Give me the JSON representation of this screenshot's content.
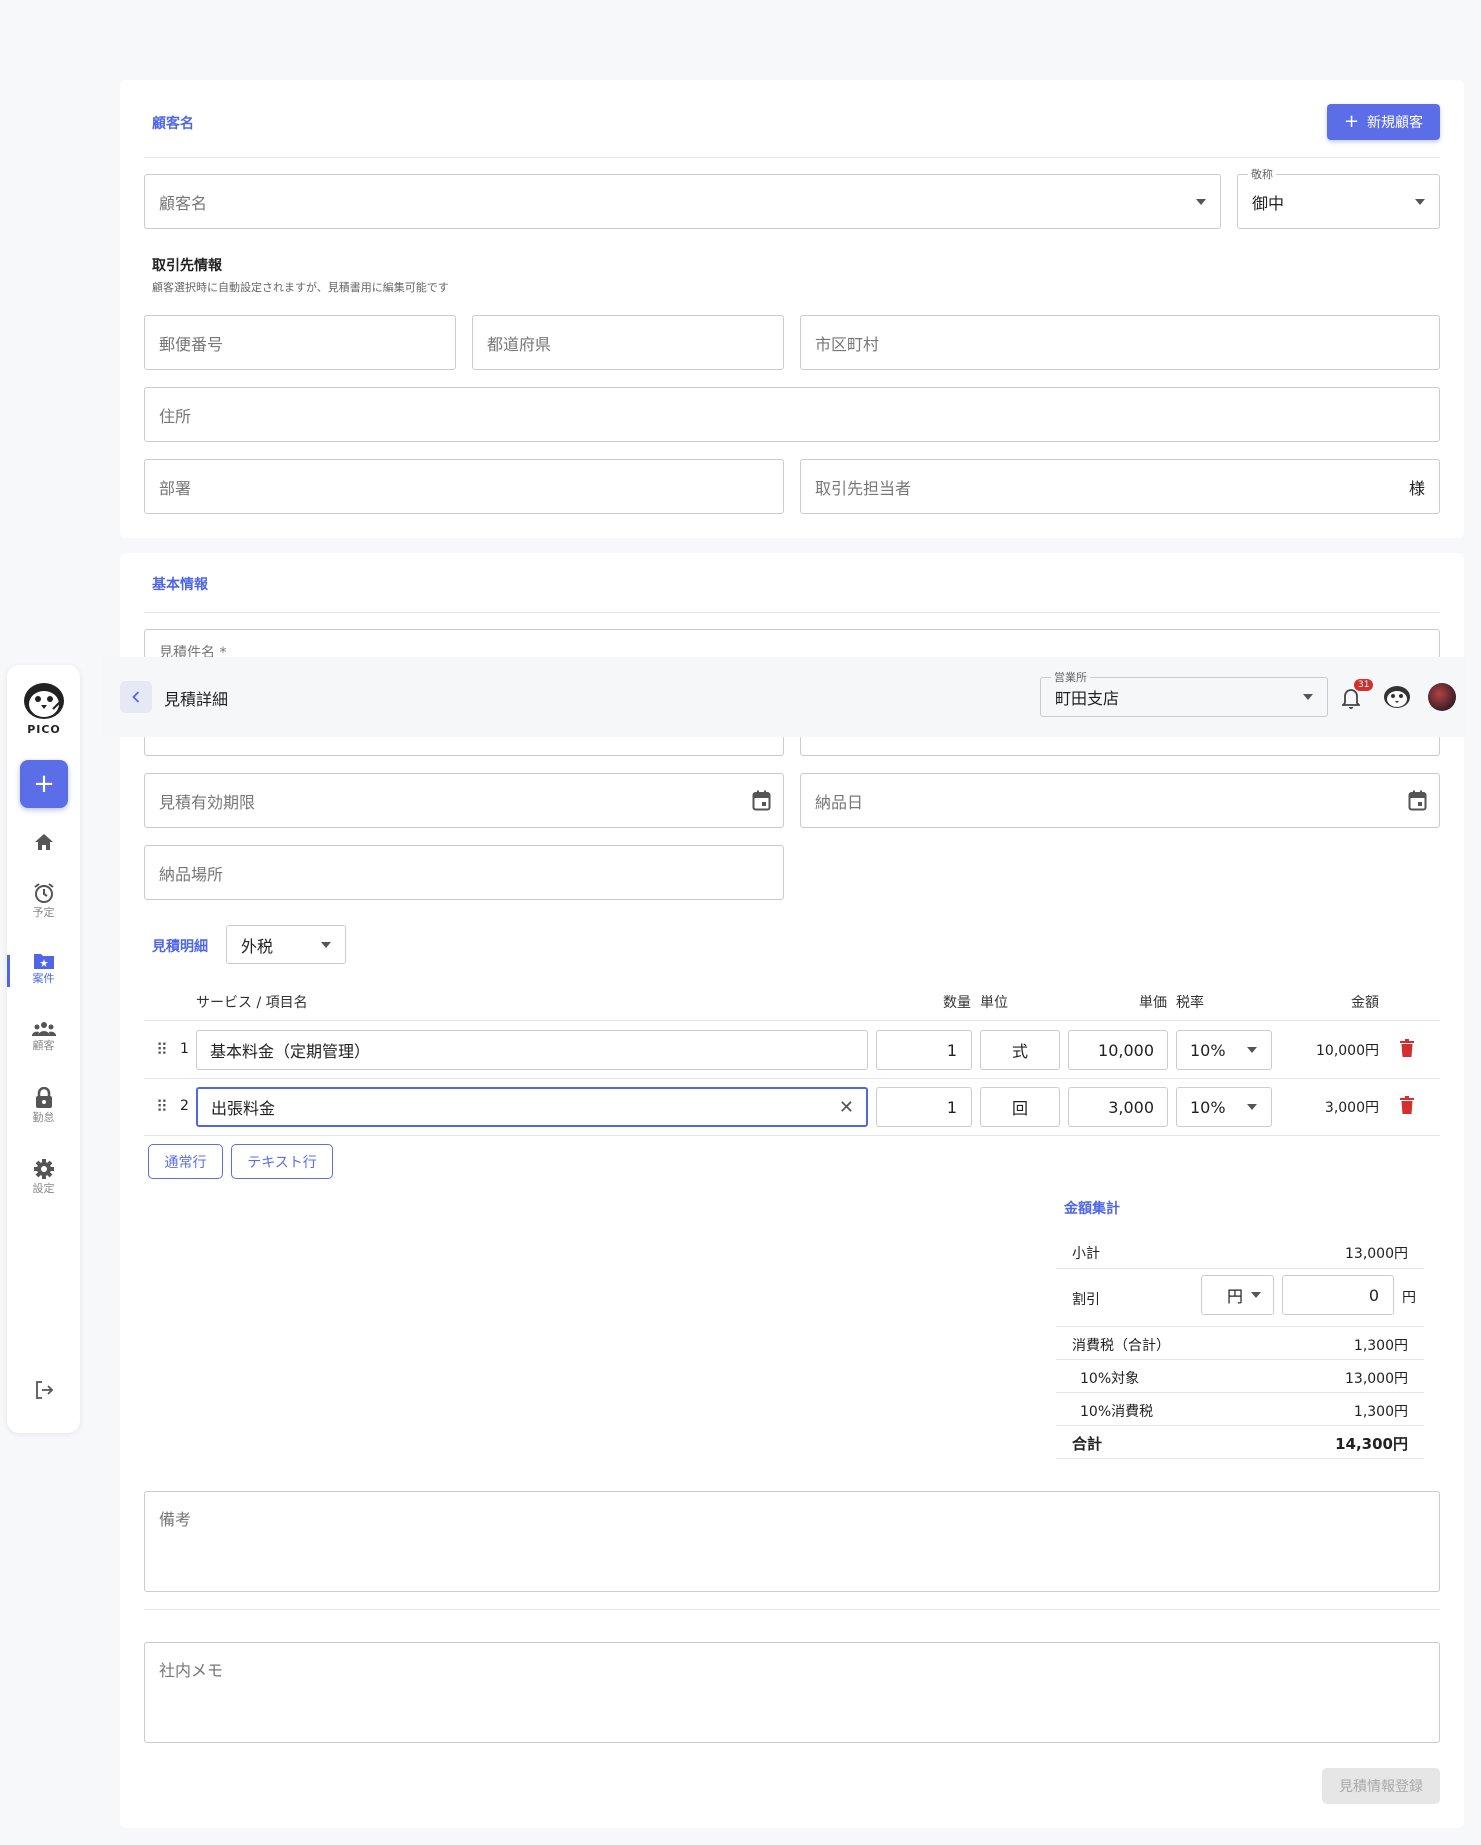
{
  "customer_section": {
    "title": "顧客名",
    "new_customer_button": "新規顧客",
    "customer_name_placeholder": "顧客名",
    "honorific_label": "敬称",
    "honorific_value": "御中",
    "partner_info_title": "取引先情報",
    "partner_info_note": "顧客選択時に自動設定されますが、見積書用に編集可能です",
    "postal_code_placeholder": "郵便番号",
    "prefecture_placeholder": "都道府県",
    "city_placeholder": "市区町村",
    "address_placeholder": "住所",
    "department_placeholder": "部署",
    "contact_person_placeholder": "取引先担当者",
    "contact_suffix": "様"
  },
  "basic_section": {
    "title": "基本情報",
    "subject_label": "見積件名 *",
    "valid_until_placeholder": "見積有効期限",
    "delivery_date_placeholder": "納品日",
    "delivery_place_placeholder": "納品場所"
  },
  "header": {
    "back_icon": "chevron-left-icon",
    "page_title": "見積詳細",
    "office_label": "営業所",
    "office_value": "町田支店",
    "notification_count": "31"
  },
  "sidebar": {
    "logo_text": "PICO",
    "items": [
      {
        "label": "",
        "icon": "home-icon"
      },
      {
        "label": "予定",
        "icon": "alarm-icon"
      },
      {
        "label": "案件",
        "icon": "folder-star-icon"
      },
      {
        "label": "顧客",
        "icon": "people-icon"
      },
      {
        "label": "勤怠",
        "icon": "lock-icon"
      },
      {
        "label": "設定",
        "icon": "gear-icon"
      }
    ]
  },
  "details": {
    "title": "見積明細",
    "tax_mode": "外税",
    "headers": {
      "service": "サービス / 項目名",
      "qty": "数量",
      "unit": "単位",
      "unit_price": "単価",
      "tax_rate": "税率",
      "amount": "金額"
    },
    "rows": [
      {
        "no": "1",
        "name": "基本料金（定期管理）",
        "qty": "1",
        "unit": "式",
        "unit_price": "10,000",
        "tax_rate": "10%",
        "amount": "10,000円"
      },
      {
        "no": "2",
        "name": "出張料金",
        "qty": "1",
        "unit": "回",
        "unit_price": "3,000",
        "tax_rate": "10%",
        "amount": "3,000円"
      }
    ],
    "add_normal_row": "通常行",
    "add_text_row": "テキスト行"
  },
  "summary": {
    "title": "金額集計",
    "subtotal_label": "小計",
    "subtotal_value": "13,000円",
    "discount_label": "割引",
    "discount_unit_select": "円",
    "discount_value": "0",
    "discount_suffix": "円",
    "tax_total_label": "消費税（合計）",
    "tax_total_value": "1,300円",
    "taxable10_label": "10%対象",
    "taxable10_value": "13,000円",
    "tax10_label": "10%消費税",
    "tax10_value": "1,300円",
    "total_label": "合計",
    "total_value": "14,300円"
  },
  "notes": {
    "remarks_placeholder": "備考",
    "internal_memo_placeholder": "社内メモ",
    "submit_button": "見積情報登録"
  },
  "colors": {
    "accent": "#5b6ee8",
    "danger": "#d32f2f"
  }
}
